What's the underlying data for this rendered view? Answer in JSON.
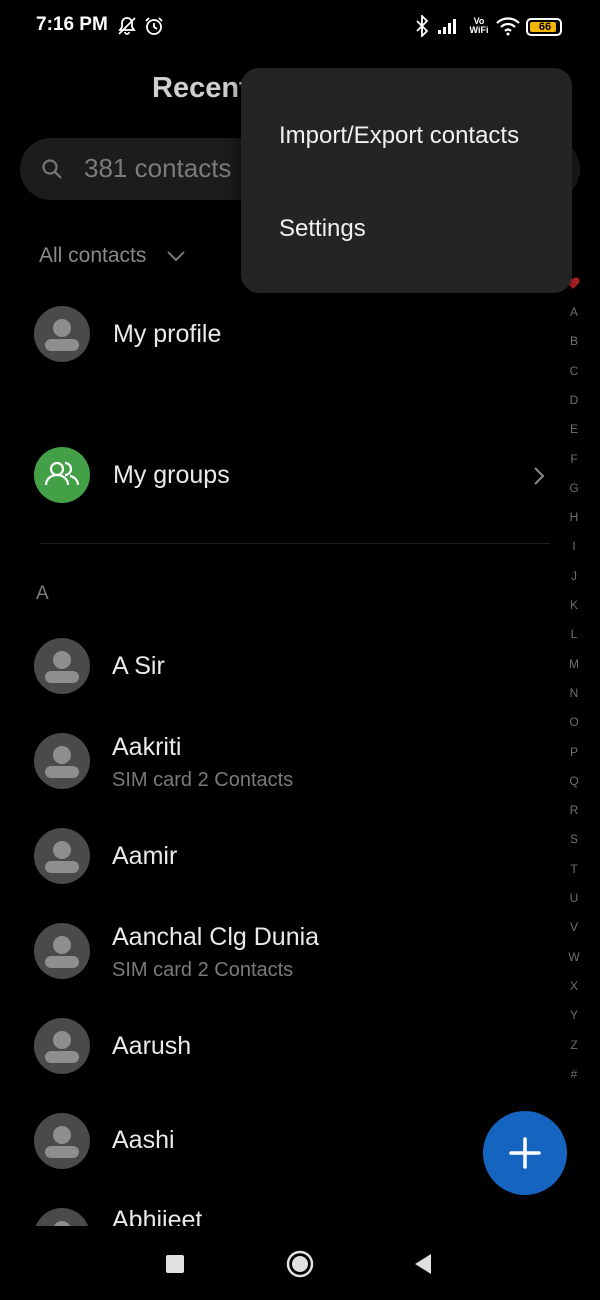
{
  "status_bar": {
    "time": "7:16 PM",
    "network_label": "Vo WiFi",
    "battery": "66",
    "icons": [
      "notification-muted-icon",
      "alarm-icon",
      "bluetooth-icon",
      "cell-signal-icon",
      "wifi-icon",
      "battery-icon"
    ]
  },
  "header": {
    "title_partial": "Recent"
  },
  "search": {
    "placeholder": "381 contacts"
  },
  "filter": {
    "label": "All contacts"
  },
  "profile": {
    "label": "My profile"
  },
  "groups": {
    "label": "My groups"
  },
  "section_header": "A",
  "contacts": [
    {
      "name": "A Sir",
      "sub": ""
    },
    {
      "name": "Aakriti",
      "sub": "SIM card 2 Contacts"
    },
    {
      "name": "Aamir",
      "sub": ""
    },
    {
      "name": "Aanchal Clg Dunia",
      "sub": "SIM card 2 Contacts"
    },
    {
      "name": "Aarush",
      "sub": ""
    },
    {
      "name": "Aashi",
      "sub": ""
    },
    {
      "name": "Abhijeet",
      "sub": ""
    }
  ],
  "alphabet_index": [
    "A",
    "B",
    "C",
    "D",
    "E",
    "F",
    "G",
    "H",
    "I",
    "J",
    "K",
    "L",
    "M",
    "N",
    "O",
    "P",
    "Q",
    "R",
    "S",
    "T",
    "U",
    "V",
    "W",
    "X",
    "Y",
    "Z",
    "#"
  ],
  "menu": {
    "items": [
      {
        "label": "Import/Export contacts"
      },
      {
        "label": "Settings"
      }
    ]
  },
  "colors": {
    "accent_fab": "#1565c0",
    "groups_avatar": "#43a047",
    "favorite_heart": "#c62828"
  }
}
